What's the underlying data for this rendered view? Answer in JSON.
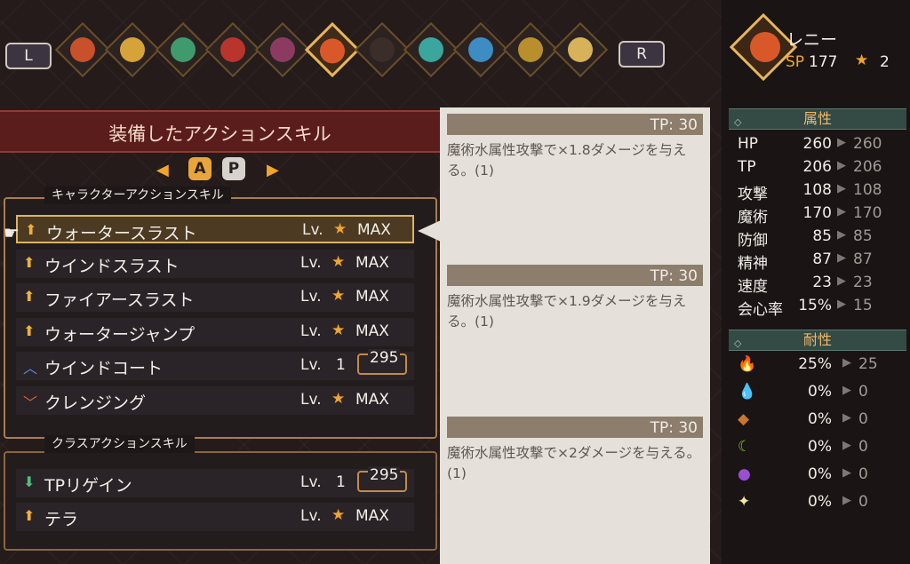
{
  "top_bar": {
    "left_button": "L",
    "right_button": "R",
    "party": [
      {
        "name": "party-member-1",
        "color": "#c8502a"
      },
      {
        "name": "party-member-2",
        "color": "#d6a23a"
      },
      {
        "name": "party-member-3",
        "color": "#3f9a6d"
      },
      {
        "name": "party-member-4",
        "color": "#b8342c"
      },
      {
        "name": "party-member-5",
        "color": "#8c3a62"
      },
      {
        "name": "party-member-6",
        "color": "#d9582a",
        "selected": true
      },
      {
        "name": "party-member-7",
        "color": "#3b2d2a"
      },
      {
        "name": "party-member-8",
        "color": "#3aa69d"
      },
      {
        "name": "party-member-9",
        "color": "#3d8cc4"
      },
      {
        "name": "party-member-10",
        "color": "#b98f2e"
      },
      {
        "name": "party-member-11",
        "color": "#d7b25a"
      }
    ]
  },
  "character": {
    "name": "レニー",
    "sp_label": "SP",
    "sp_value": "177",
    "stars": "2"
  },
  "attributes": {
    "header": "属性",
    "rows": [
      {
        "label": "HP",
        "value": "260",
        "next": "260"
      },
      {
        "label": "TP",
        "value": "206",
        "next": "206"
      },
      {
        "label": "攻撃",
        "value": "108",
        "next": "108"
      },
      {
        "label": "魔術",
        "value": "170",
        "next": "170"
      },
      {
        "label": "防御",
        "value": "85",
        "next": "85"
      },
      {
        "label": "精神",
        "value": "87",
        "next": "87"
      },
      {
        "label": "速度",
        "value": "23",
        "next": "23"
      },
      {
        "label": "会心率",
        "value": "15%",
        "next": "15"
      }
    ]
  },
  "resistances": {
    "header": "耐性",
    "rows": [
      {
        "icon": "fire-icon",
        "value": "25%",
        "next": "25",
        "color": "#e85a24"
      },
      {
        "icon": "water-icon",
        "value": "0%",
        "next": "0",
        "color": "#6fa8e0"
      },
      {
        "icon": "earth-icon",
        "value": "0%",
        "next": "0",
        "color": "#c9762e"
      },
      {
        "icon": "wind-icon",
        "value": "0%",
        "next": "0",
        "color": "#79c83a"
      },
      {
        "icon": "dark-icon",
        "value": "0%",
        "next": "0",
        "color": "#9a4fd3"
      },
      {
        "icon": "light-icon",
        "value": "0%",
        "next": "0",
        "color": "#f3e9a5"
      }
    ]
  },
  "skills_panel": {
    "title": "装備したアクションスキル",
    "tab_a": "A",
    "tab_p": "P",
    "character_section_label": "キャラクターアクションスキル",
    "class_section_label": "クラスアクションスキル",
    "character_skills": [
      {
        "name": "ウォータースラスト",
        "lv_label": "Lv.",
        "level": "MAX",
        "icon": "up-arrow-gold-icon",
        "active": true
      },
      {
        "name": "ウインドスラスト",
        "lv_label": "Lv.",
        "level": "MAX",
        "icon": "up-arrow-gold-icon"
      },
      {
        "name": "ファイアースラスト",
        "lv_label": "Lv.",
        "level": "MAX",
        "icon": "up-arrow-gold-icon"
      },
      {
        "name": "ウォータージャンプ",
        "lv_label": "Lv.",
        "level": "MAX",
        "icon": "up-arrow-gold-icon"
      },
      {
        "name": "ウインドコート",
        "lv_label": "Lv.",
        "level": "1",
        "cost": "295",
        "icon": "chevron-up-icon"
      },
      {
        "name": "クレンジング",
        "lv_label": "Lv.",
        "level": "MAX",
        "icon": "chevron-down-icon"
      }
    ],
    "class_skills": [
      {
        "name": "TPリゲイン",
        "lv_label": "Lv.",
        "level": "1",
        "cost": "295",
        "icon": "down-arrow-green-icon"
      },
      {
        "name": "テラ",
        "lv_label": "Lv.",
        "level": "MAX",
        "icon": "up-arrow-gold-icon"
      }
    ]
  },
  "descriptions": [
    {
      "tp": "TP: 30",
      "text": "魔術水属性攻撃で×1.8ダメージを与える。(1)"
    },
    {
      "tp": "TP: 30",
      "text": "魔術水属性攻撃で×1.9ダメージを与える。(1)"
    },
    {
      "tp": "TP: 30",
      "text": "魔術水属性攻撃で×2ダメージを与える。(1)"
    }
  ]
}
